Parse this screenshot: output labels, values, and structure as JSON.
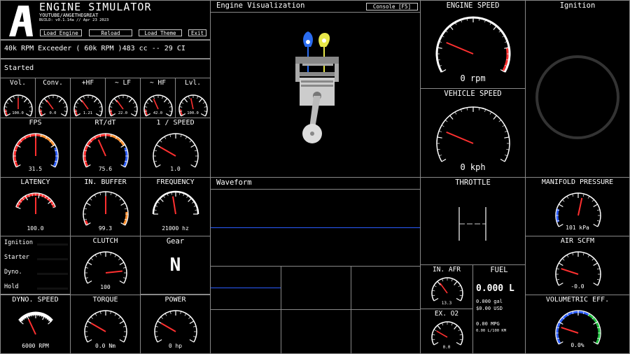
{
  "header": {
    "logo_letter": "A",
    "title": "ENGINE SIMULATOR",
    "subtitle": "YOUTUBE/ANGETHEGREAT",
    "build": "BUILD: v0.1.14a // Apr 23 2023",
    "buttons": [
      "Load Engine",
      "Reload",
      "Load Theme",
      "Exit"
    ]
  },
  "engine_name": "40k RPM Exceeder ( 60k RPM )483 cc -- 29 CI",
  "status": "Started",
  "mini_gauges": [
    {
      "title": "Vol.",
      "value": "100.0"
    },
    {
      "title": "Conv.",
      "value": "0.0"
    },
    {
      "title": "+HF",
      "value": "1.21"
    },
    {
      "title": "~ LF",
      "value": "22.0"
    },
    {
      "title": "~ HF",
      "value": "42.0"
    },
    {
      "title": "Lvl.",
      "value": "100.0"
    }
  ],
  "perf_gauges": [
    {
      "title": "FPS",
      "value": "31.5",
      "fraction": 0.5
    },
    {
      "title": "RT/dT",
      "value": "75.6",
      "fraction": 0.4
    },
    {
      "title": "1 / SPEED",
      "value": "1.0",
      "fraction": 0.25
    }
  ],
  "mid_gauges": [
    {
      "title": "LATENCY",
      "value": "100.0",
      "fraction": 0.5
    },
    {
      "title": "IN. BUFFER",
      "value": "99.3",
      "fraction": 0.5
    },
    {
      "title": "FREQUENCY",
      "value": "21000 hz",
      "fraction": 0.45
    }
  ],
  "controls": {
    "items": [
      "Ignition",
      "Starter",
      "Dyno.",
      "Hold"
    ]
  },
  "clutch": {
    "title": "CLUTCH",
    "value": "100",
    "fraction": 0.85
  },
  "gear": {
    "title": "Gear",
    "value": "N"
  },
  "bottom_gauges": [
    {
      "title": "DYNO. SPEED",
      "value": "6000 RPM",
      "fraction": 0.4
    },
    {
      "title": "TORQUE",
      "value": "0.0 Nm",
      "fraction": 0.25
    },
    {
      "title": "POWER",
      "value": "0 hp",
      "fraction": 0.25
    }
  ],
  "engine_viz": {
    "title": "Engine Visualization",
    "console_button": "Console [F5]"
  },
  "waveform": {
    "title": "Waveform"
  },
  "engine_speed": {
    "title": "ENGINE SPEED",
    "value": "0 rpm",
    "fraction": 0.2
  },
  "vehicle_speed": {
    "title": "VEHICLE SPEED",
    "value": "0 kph",
    "fraction": 0.2
  },
  "ignition_panel": {
    "title": "Ignition"
  },
  "throttle": {
    "title": "THROTTLE"
  },
  "manifold": {
    "title": "MANIFOLD PRESSURE",
    "value": "101 kPa",
    "fraction": 0.6
  },
  "air_scfm": {
    "title": "AIR SCFM",
    "value": "-0.0",
    "fraction": 0.25
  },
  "vol_eff": {
    "title": "VOLUMETRIC EFF.",
    "value": "0.0%",
    "fraction": 0.25
  },
  "in_afr": {
    "title": "IN. AFR",
    "value": "13.3",
    "fraction": 0.35
  },
  "ex_o2": {
    "title": "EX. O2",
    "value": "0.0",
    "fraction": 0.25
  },
  "fuel": {
    "title": "FUEL",
    "big": "0.000 L",
    "gal": "0.000 gal",
    "usd": "$0.00 USD",
    "mpg": "0.00 MPG",
    "l100": "0.00 L/100 KM"
  }
}
